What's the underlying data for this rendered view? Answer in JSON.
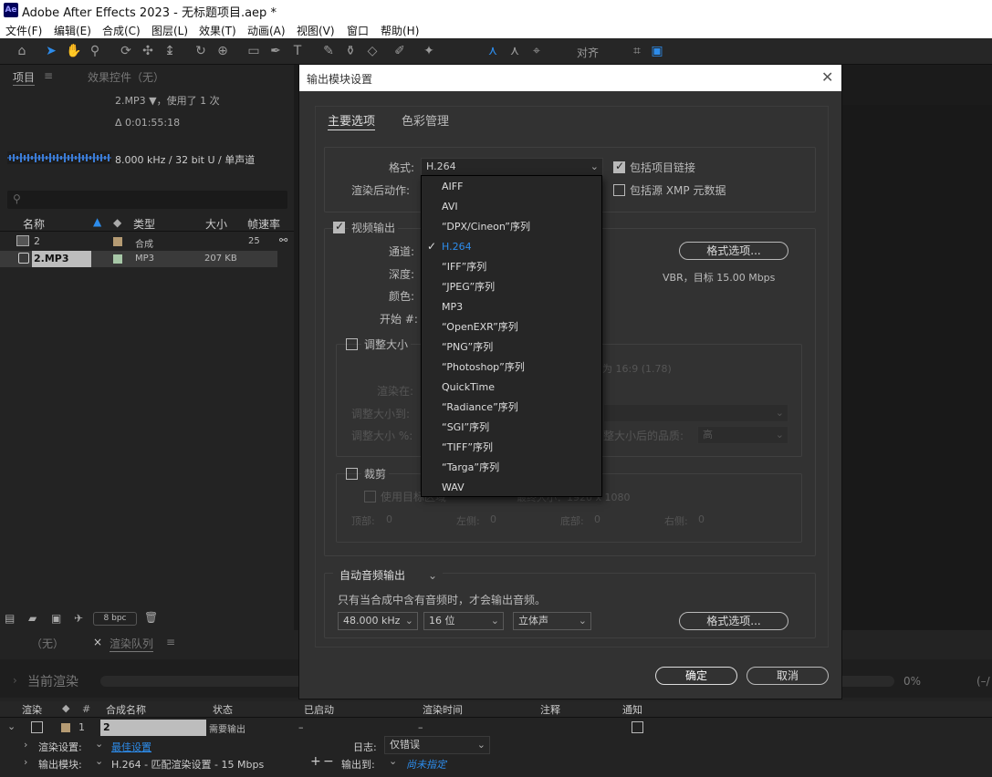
{
  "app": {
    "title": "Adobe After Effects 2023 - 无标题项目.aep *",
    "logo": "Ae"
  },
  "menu": [
    "文件(F)",
    "编辑(E)",
    "合成(C)",
    "图层(L)",
    "效果(T)",
    "动画(A)",
    "视图(V)",
    "窗口",
    "帮助(H)"
  ],
  "toolbar": {
    "align_label": "对齐"
  },
  "project_panel": {
    "tab_project": "项目",
    "tab_effects": "效果控件（无）",
    "item_name": "2.MP3 ▼，使用了 1 次",
    "duration": "Δ 0:01:55:18",
    "audio_info": "8.000 kHz / 32 bit U / 单声道",
    "columns": [
      "名称",
      "类型",
      "大小",
      "帧速率"
    ],
    "rows": [
      {
        "name": "2",
        "type": "合成",
        "size": "",
        "fps": "25"
      },
      {
        "name": "2.MP3",
        "type": "MP3",
        "size": "207 KB",
        "fps": ""
      }
    ],
    "bpc": "8 bpc"
  },
  "dialog": {
    "title": "输出模块设置",
    "tabs": [
      "主要选项",
      "色彩管理"
    ],
    "format_label": "格式:",
    "format_value": "H.264",
    "post_render_label": "渲染后动作:",
    "include_project_link": "包括项目链接",
    "include_xmp": "包括源 XMP 元数据",
    "video_output": "视频输出",
    "channels_label": "通道:",
    "depth_label": "深度:",
    "color_label": "颜色:",
    "start_label": "开始 #:",
    "format_options": "格式选项...",
    "vbr_info": "VBR，目标 15.00 Mbps",
    "resize": "调整大小",
    "ratio_text": "为 16:9 (1.78)",
    "render_at": "渲染在:",
    "resize_to": "调整大小到:",
    "resize_pct": "调整大小 %:",
    "resize_quality_label": "整大小后的品质:",
    "resize_quality_value": "高",
    "crop": "裁剪",
    "use_roi": "使用目标区域",
    "final_size": "最终大小：1920 x 1080",
    "top": "顶部:",
    "left": "左侧:",
    "bottom": "底部:",
    "right": "右侧:",
    "zero": "0",
    "audio_mode": "自动音频输出",
    "audio_note": "只有当合成中含有音频时，才会输出音频。",
    "sample_rate": "48.000 kHz",
    "bit_depth": "16 位",
    "channels": "立体声",
    "ok": "确定",
    "cancel": "取消"
  },
  "format_dropdown": {
    "options": [
      "AIFF",
      "AVI",
      "“DPX/Cineon”序列",
      "H.264",
      "“IFF”序列",
      "“JPEG”序列",
      "MP3",
      "“OpenEXR”序列",
      "“PNG”序列",
      "“Photoshop”序列",
      "QuickTime",
      "“Radiance”序列",
      "“SGI”序列",
      "“TIFF”序列",
      "“Targa”序列",
      "WAV"
    ],
    "selected": "H.264"
  },
  "render_queue": {
    "tab_none": "（无）",
    "tab_queue": "渲染队列",
    "current_render": "当前渲染",
    "progress": "0%",
    "progress_right": "(–/",
    "columns": [
      "渲染",
      "#",
      "合成名称",
      "状态",
      "已启动",
      "渲染时间",
      "注释",
      "通知"
    ],
    "row": {
      "num": "1",
      "comp": "2",
      "status": "需要输出",
      "started": "–",
      "time": "–"
    },
    "render_settings_label": "渲染设置:",
    "render_settings_value": "最佳设置",
    "log_label": "日志:",
    "log_value": "仅错误",
    "output_module_label": "输出模块:",
    "output_module_value": "H.264 - 匹配渲染设置 - 15 Mbps",
    "output_to_label": "输出到:",
    "output_to_value": "尚未指定"
  },
  "colors": {
    "accent": "#2d8ceb",
    "selected_blue": "#2d8ceb"
  }
}
